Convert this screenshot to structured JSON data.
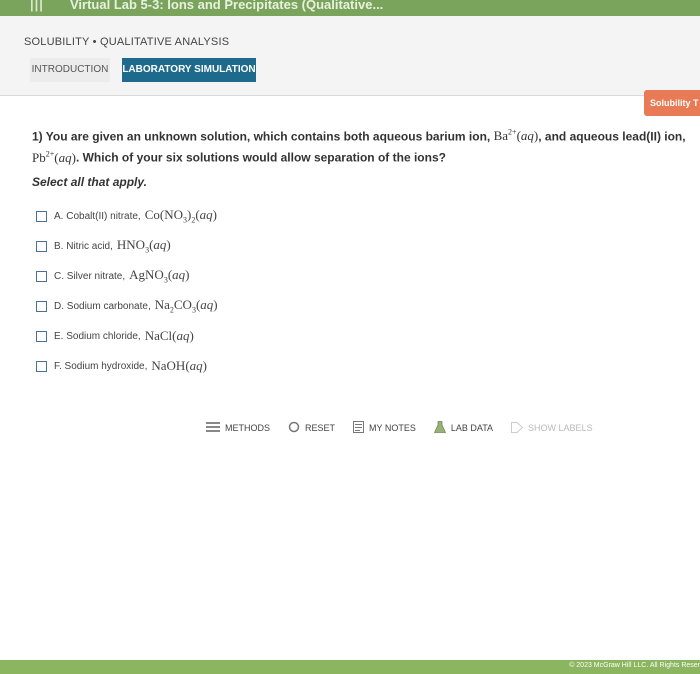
{
  "window": {
    "title": "Virtual Lab 5-3: Ions and Precipitates (Qualitative..."
  },
  "breadcrumb": "SOLUBILITY • QUALITATIVE ANALYSIS",
  "tabs": [
    {
      "label": "INTRODUCTION"
    },
    {
      "label": "LABORATORY SIMULATION"
    }
  ],
  "side_button": "Solubility T",
  "question": {
    "lead": "1) You are given an unknown solution, which contains both aqueous barium ion, ",
    "mid": ", and aqueous lead(II) ion,",
    "tail": ". Which of your six solutions would allow separation of the ions?"
  },
  "prompt": "Select all that apply.",
  "choices": [
    {
      "label": "A. Cobalt(II) nitrate,"
    },
    {
      "label": "B. Nitric acid,"
    },
    {
      "label": "C. Silver nitrate,"
    },
    {
      "label": "D. Sodium carbonate,"
    },
    {
      "label": "E. Sodium chloride,"
    },
    {
      "label": "F. Sodium hydroxide,"
    }
  ],
  "toolbar": {
    "methods": "METHODS",
    "reset": "RESET",
    "my_notes": "MY NOTES",
    "lab_data": "LAB DATA",
    "show_labels": "SHOW LABELS"
  },
  "footer": "© 2023 McGraw Hill LLC. All Rights Reser",
  "colors": {
    "accent": "#1e6a8d",
    "topbar": "#7aa45c",
    "side_button": "#e87a55"
  }
}
